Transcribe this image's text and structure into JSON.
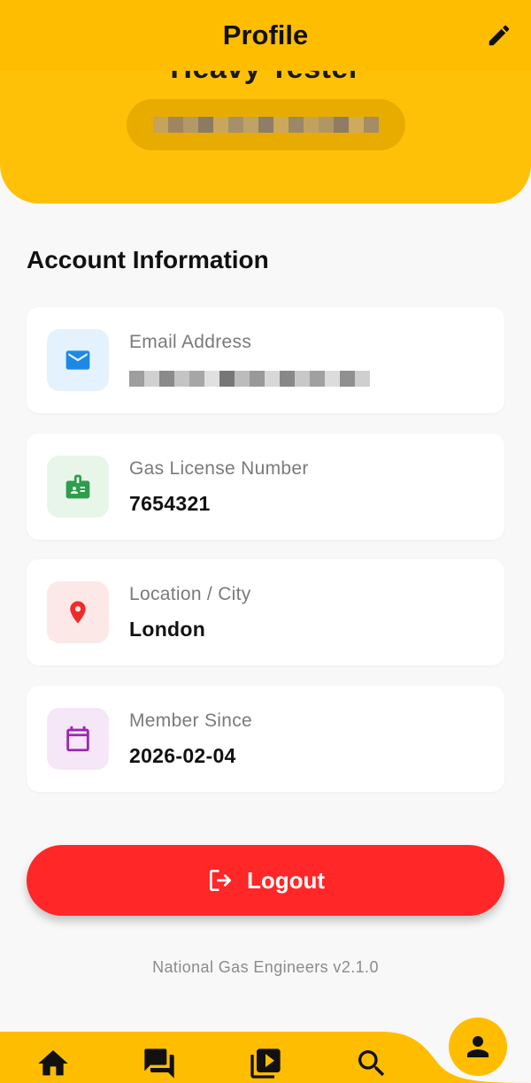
{
  "header": {
    "title": "Profile",
    "name": "Heavy Tester",
    "edit_icon": "pencil-icon"
  },
  "account": {
    "section_title": "Account Information",
    "items": [
      {
        "label": "Email Address",
        "value": "",
        "icon": "mail-icon",
        "icon_color": "#1e88e5",
        "icon_bg": "#e3f2fd"
      },
      {
        "label": "Gas License Number",
        "value": "7654321",
        "icon": "badge-icon",
        "icon_color": "#2e9d4e",
        "icon_bg": "#e8f5e9"
      },
      {
        "label": "Location / City",
        "value": "London",
        "icon": "location-pin-icon",
        "icon_color": "#f02b2b",
        "icon_bg": "#fde8e8"
      },
      {
        "label": "Member Since",
        "value": "2026-02-04",
        "icon": "calendar-icon",
        "icon_color": "#9c27b0",
        "icon_bg": "#f5e6f8"
      }
    ]
  },
  "logout": {
    "label": "Logout",
    "icon": "logout-icon"
  },
  "footer": {
    "version": "National Gas Engineers v2.1.0"
  },
  "nav": {
    "items": [
      {
        "icon": "home-icon"
      },
      {
        "icon": "chat-icon"
      },
      {
        "icon": "video-library-icon"
      },
      {
        "icon": "search-icon"
      }
    ],
    "active": {
      "icon": "person-icon"
    }
  },
  "colors": {
    "accent": "#ffbd00",
    "danger": "#ff2727"
  }
}
